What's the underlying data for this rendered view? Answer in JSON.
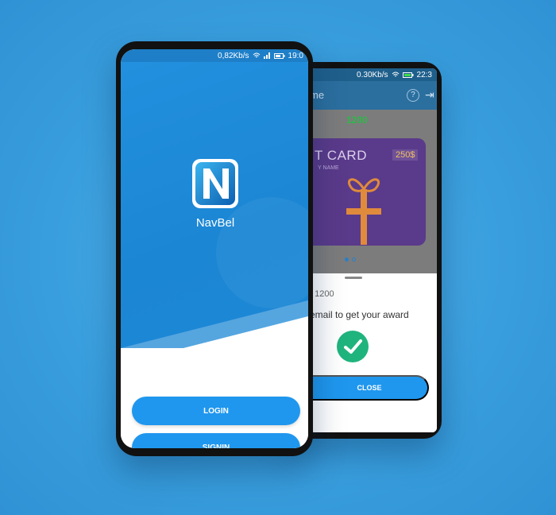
{
  "back_phone": {
    "status": {
      "speed": "0.30Kb/s",
      "time": "22:3"
    },
    "app_bar": {
      "title": "me",
      "help_label": "?",
      "exit_glyph": "⇥"
    },
    "points": "1200",
    "gift_card": {
      "title": "T CARD",
      "amount": "250$",
      "name": "Y NAME"
    },
    "sheet": {
      "points_text": ": 1200",
      "message": "email to get your award",
      "close_label": "CLOSE"
    }
  },
  "front_phone": {
    "status": {
      "speed": "0,82Kb/s",
      "time": "19:0"
    },
    "app_name": "NavBel",
    "login_label": "LOGIN",
    "signin_label": "SIGNIN"
  },
  "colors": {
    "background": "#3a9fde",
    "primary_button": "#1f97ee",
    "success": "#1fb47e",
    "points_green": "#2eb84a"
  },
  "icons": [
    "wifi-icon",
    "signal-icon",
    "battery-icon",
    "help-icon",
    "exit-icon",
    "check-icon",
    "navbel-logo-icon"
  ]
}
